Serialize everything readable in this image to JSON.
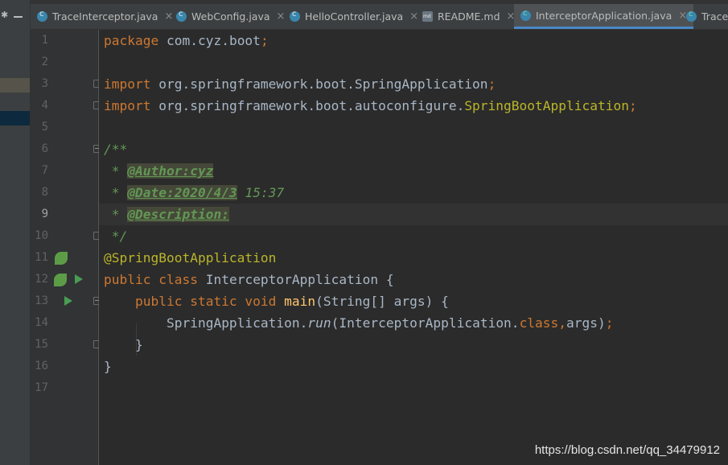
{
  "tabs": [
    {
      "label": "TraceInterceptor.java",
      "close": "×",
      "icon": "java-class-icon"
    },
    {
      "label": "WebConfig.java",
      "close": "×",
      "icon": "java-class-icon"
    },
    {
      "label": "HelloController.java",
      "close": "×",
      "icon": "java-class-icon"
    },
    {
      "label": "README.md",
      "close": "×",
      "icon": "markdown-file-icon"
    },
    {
      "label": "InterceptorApplication.java",
      "close": "×",
      "icon": "spring-boot-class-icon",
      "active": true
    },
    {
      "label": "Trace",
      "icon": "spring-boot-class-icon"
    }
  ],
  "gutter": {
    "line_numbers": [
      "1",
      "2",
      "3",
      "4",
      "5",
      "6",
      "7",
      "8",
      "9",
      "10",
      "11",
      "12",
      "13",
      "14",
      "15",
      "16",
      "17"
    ],
    "current_line": "9"
  },
  "code": {
    "l1": {
      "kw": "package",
      "rest": " com.cyz.boot",
      "semi": ";"
    },
    "l3": {
      "kw": "import",
      "rest": " org.springframework.boot.SpringApplication",
      "semi": ";"
    },
    "l4": {
      "kw": "import",
      "rest": " org.springframework.boot.autoconfigure.",
      "ann": "SpringBootApplication",
      "semi": ";"
    },
    "l6": {
      "text": "/**"
    },
    "l7": {
      "star": " * ",
      "tag": "@Author:cyz"
    },
    "l8": {
      "star": " * ",
      "tag": "@Date:2020/4/3",
      "rest": " 15:37"
    },
    "l9": {
      "star": " * ",
      "tag": "@Description:"
    },
    "l10": {
      "text": " */"
    },
    "l11": {
      "ann": "@SpringBootApplication"
    },
    "l12": {
      "kw1": "public",
      "kw2": " class",
      "rest": " InterceptorApplication {"
    },
    "l13": {
      "indent": "    ",
      "kw": "public static void",
      "fn": " main",
      "rest": "(String[] args) {"
    },
    "l14": {
      "indent": "        ",
      "a": "SpringApplication.",
      "it": "run",
      "b": "(InterceptorApplication.",
      "kw": "class",
      "comma": ",",
      "c": "args)",
      "semi": ";"
    },
    "l15": {
      "text": "    }"
    },
    "l16": {
      "text": "}"
    }
  },
  "watermark": "https://blog.csdn.net/qq_34479912",
  "colors": {
    "keyword": "#cc7832",
    "annotation": "#bbb529",
    "method": "#ffc66d",
    "javadoc": "#629755",
    "text": "#a9b7c6",
    "tab_underline": "#4a88c7"
  }
}
